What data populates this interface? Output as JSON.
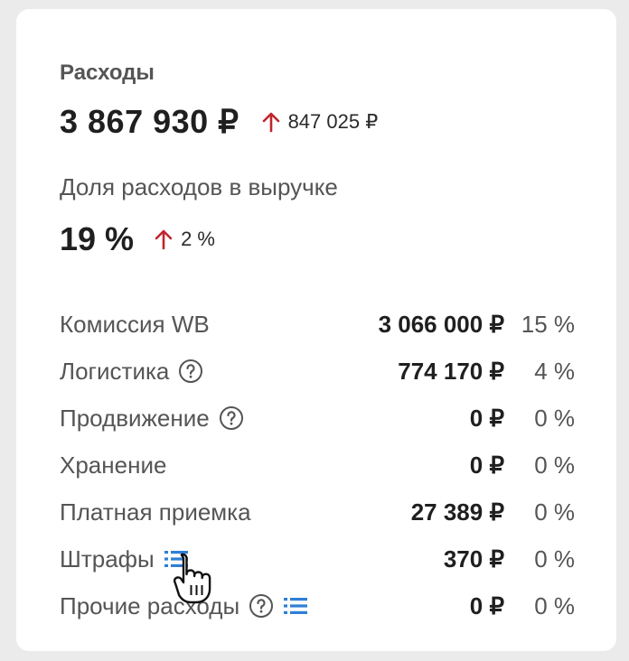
{
  "expenses": {
    "title": "Расходы",
    "total": "3 867 930 ₽",
    "delta": "847 025 ₽"
  },
  "share": {
    "title": "Доля расходов в выручке",
    "value": "19 %",
    "delta": "2 %"
  },
  "breakdown": [
    {
      "label": "Комиссия WB",
      "amount": "3 066 000 ₽",
      "percent": "15 %",
      "help": false,
      "list": false
    },
    {
      "label": "Логистика",
      "amount": "774 170 ₽",
      "percent": "4 %",
      "help": true,
      "list": false
    },
    {
      "label": "Продвижение",
      "amount": "0 ₽",
      "percent": "0 %",
      "help": true,
      "list": false
    },
    {
      "label": "Хранение",
      "amount": "0 ₽",
      "percent": "0 %",
      "help": false,
      "list": false
    },
    {
      "label": "Платная приемка",
      "amount": "27 389 ₽",
      "percent": "0 %",
      "help": false,
      "list": false
    },
    {
      "label": "Штрафы",
      "amount": "370 ₽",
      "percent": "0 %",
      "help": false,
      "list": true
    },
    {
      "label": "Прочие расходы",
      "amount": "0 ₽",
      "percent": "0 %",
      "help": true,
      "list": true
    }
  ],
  "colors": {
    "arrow_up": "#c0262d",
    "list_icon": "#2f7fd6",
    "help_icon": "#555555"
  },
  "icons": {
    "delta_arrow": "arrow-up-icon",
    "help": "question-circle-icon",
    "list": "list-icon",
    "cursor": "hand-pointer-icon"
  }
}
